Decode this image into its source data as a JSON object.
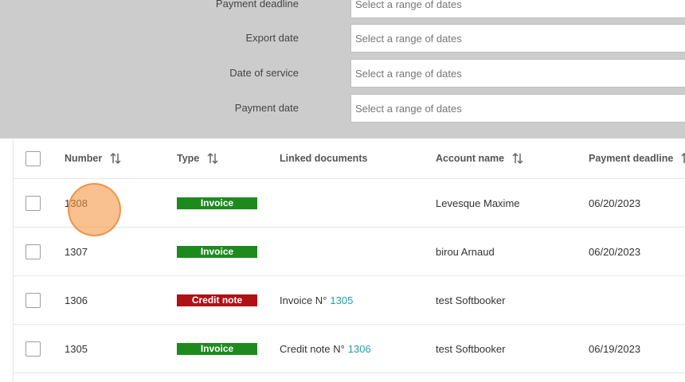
{
  "filters": [
    {
      "label": "Payment deadline",
      "placeholder": "Select a range of dates"
    },
    {
      "label": "Export date",
      "placeholder": "Select a range of dates"
    },
    {
      "label": "Date of service",
      "placeholder": "Select a range of dates"
    },
    {
      "label": "Payment date",
      "placeholder": "Select a range of dates"
    }
  ],
  "table": {
    "headers": {
      "number": "Number",
      "type": "Type",
      "linked": "Linked documents",
      "account": "Account name",
      "deadline": "Payment deadline"
    },
    "rows": [
      {
        "number": "1308",
        "type": "Invoice",
        "linked_prefix": "",
        "linked_ref": "",
        "account": "Levesque Maxime",
        "deadline": "06/20/2023"
      },
      {
        "number": "1307",
        "type": "Invoice",
        "linked_prefix": "",
        "linked_ref": "",
        "account": "birou Arnaud",
        "deadline": "06/20/2023"
      },
      {
        "number": "1306",
        "type": "Credit note",
        "linked_prefix": "Invoice N°",
        "linked_ref": "1305",
        "account": "test Softbooker",
        "deadline": ""
      },
      {
        "number": "1305",
        "type": "Invoice",
        "linked_prefix": "Credit note N°",
        "linked_ref": "1306",
        "account": "test Softbooker",
        "deadline": "06/19/2023"
      }
    ]
  },
  "colors": {
    "invoice_badge": "#1e8a1e",
    "credit_badge": "#b01116",
    "link": "#2a9d9d",
    "filter_panel": "#cccccc"
  },
  "icons": {
    "sort": "sort-arrows-icon"
  }
}
